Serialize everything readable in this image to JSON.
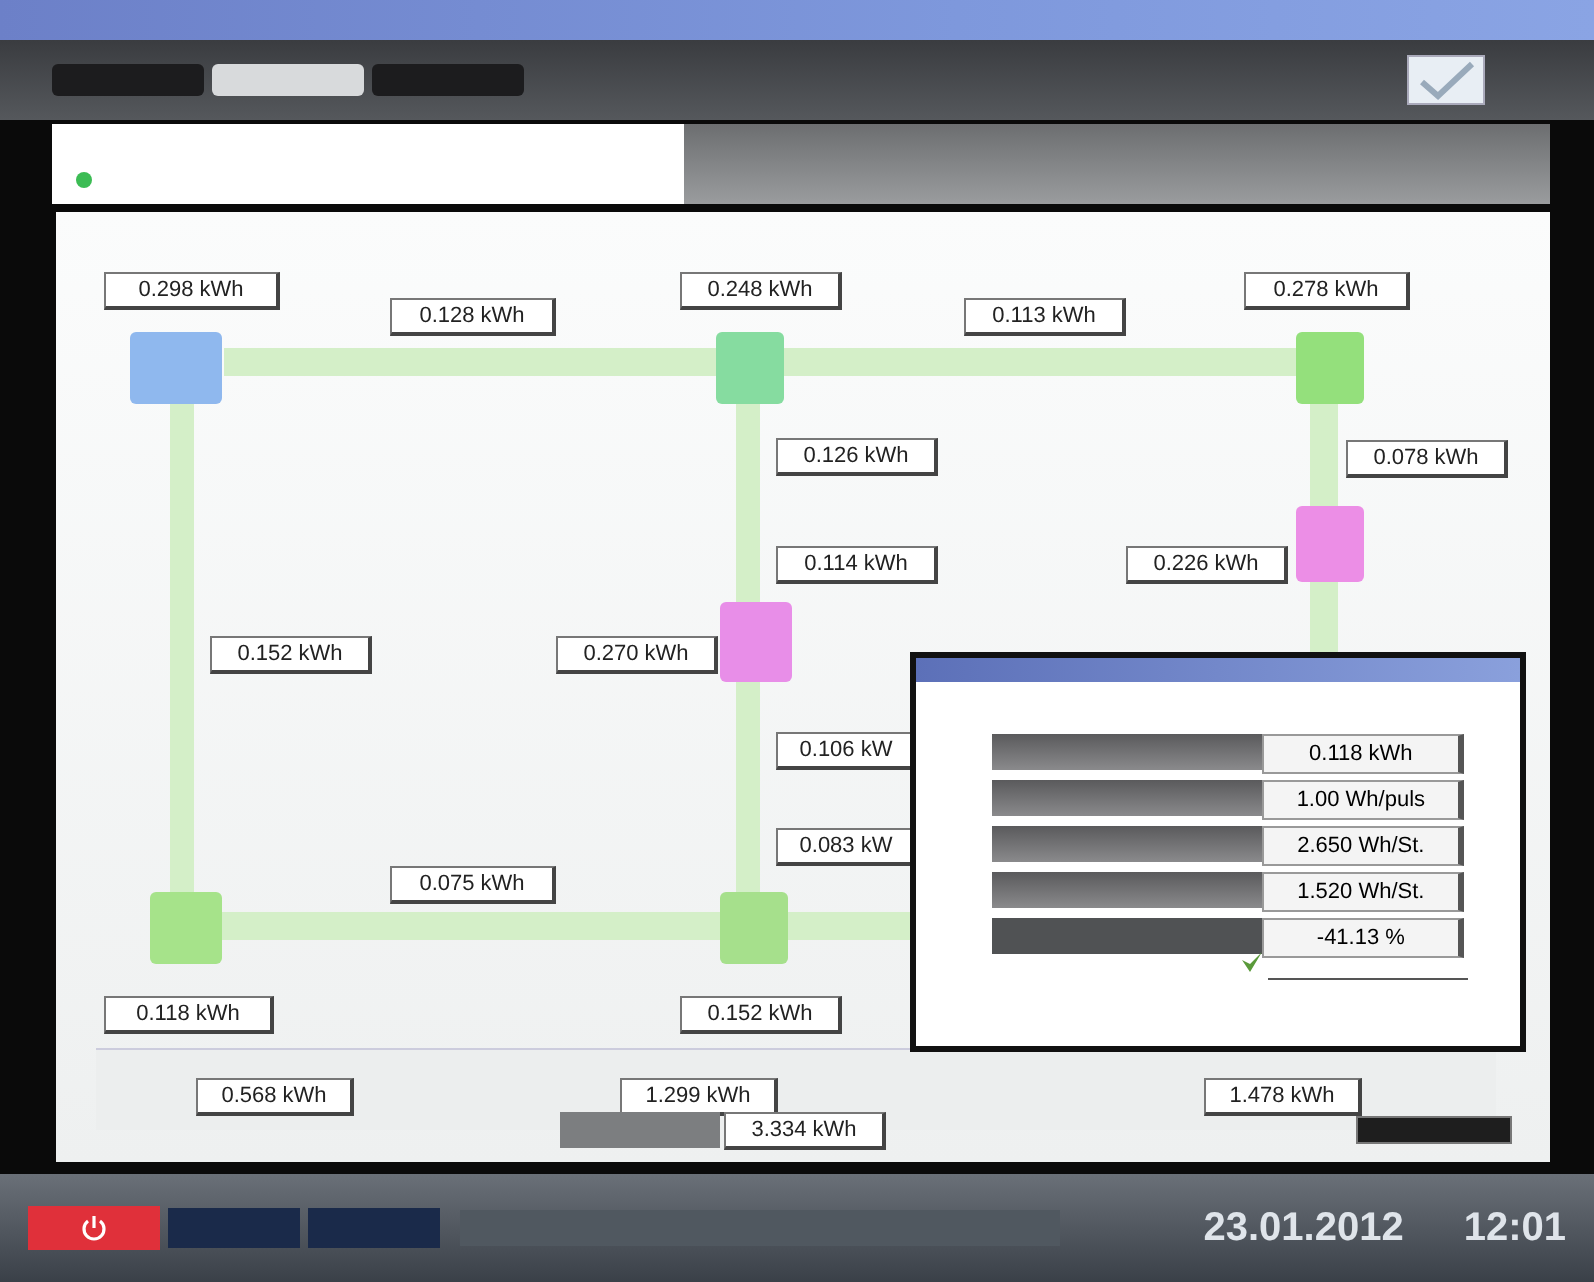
{
  "tabs": [
    {
      "selected": false
    },
    {
      "selected": true
    },
    {
      "selected": false
    }
  ],
  "diagram": {
    "readings": [
      "0.298 kWh",
      "0.128 kWh",
      "0.248 kWh",
      "0.113 kWh",
      "0.278 kWh",
      "0.126 kWh",
      "0.078 kWh",
      "0.114 kWh",
      "0.226 kWh",
      "0.152 kWh",
      "0.270 kWh",
      "0.106 kW",
      "0.083 kW",
      "0.075 kWh",
      "0.118 kWh",
      "0.152 kWh"
    ],
    "nodes": [
      {
        "color": "#8fb8ee"
      },
      {
        "color": "#86dca0"
      },
      {
        "color": "#94e07c"
      },
      {
        "color": "#ec8ee6"
      },
      {
        "color": "#e88ee8"
      },
      {
        "color": "#a6e38a"
      },
      {
        "color": "#a6e08c"
      }
    ]
  },
  "totals": {
    "groups": [
      "0.568 kWh",
      "1.299 kWh",
      "1.478 kWh"
    ],
    "sum": "3.334 kWh"
  },
  "popup": {
    "rows": [
      {
        "kind": "input",
        "value": "0.118 kWh"
      },
      {
        "kind": "input",
        "value": "1.00 Wh/puls"
      },
      {
        "kind": "input",
        "value": "2.650 Wh/St."
      },
      {
        "kind": "input",
        "value": "1.520 Wh/St."
      },
      {
        "kind": "result",
        "value": "-41.13 %"
      }
    ],
    "ok": true
  },
  "taskbar": {
    "date": "23.01.2012",
    "time": "12:01"
  }
}
